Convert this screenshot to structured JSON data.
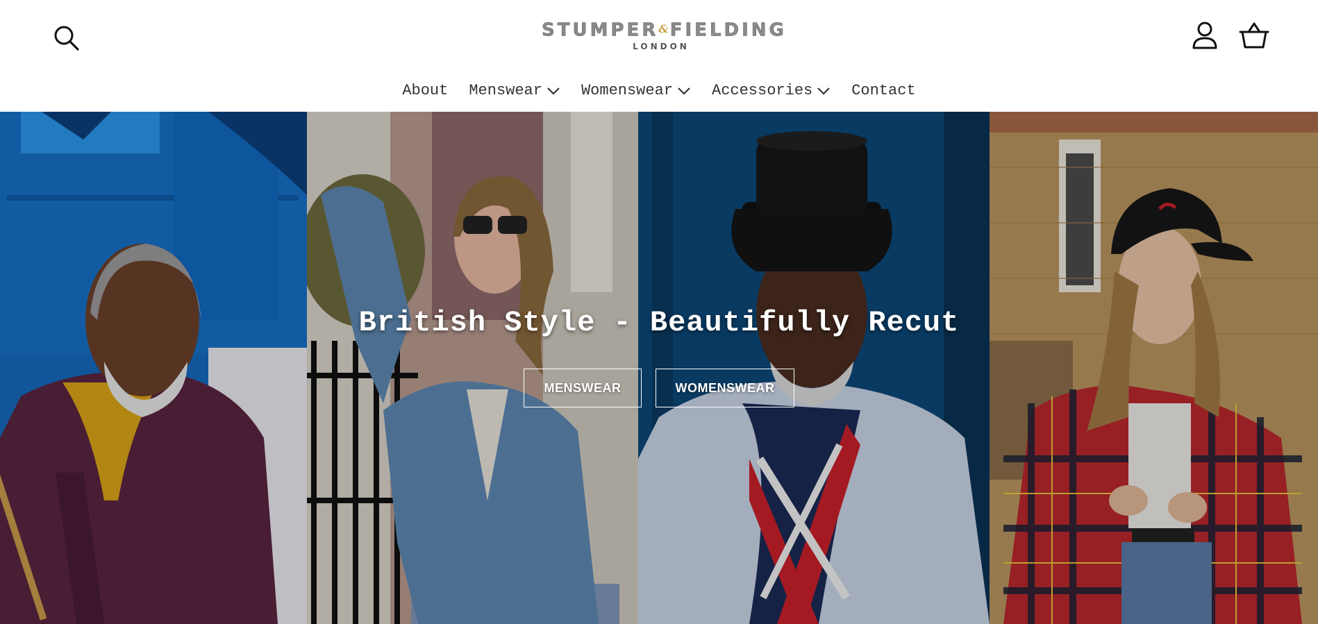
{
  "header": {
    "logo": {
      "main_left": "STUMPER",
      "ampersand": "&",
      "main_right": "FIELDING",
      "sub": "LONDON"
    },
    "icons": {
      "search": "search-icon",
      "account": "user-icon",
      "cart": "basket-icon"
    }
  },
  "nav": {
    "items": [
      {
        "label": "About",
        "has_dropdown": false
      },
      {
        "label": "Menswear",
        "has_dropdown": true
      },
      {
        "label": "Womenswear",
        "has_dropdown": true
      },
      {
        "label": "Accessories",
        "has_dropdown": true
      },
      {
        "label": "Contact",
        "has_dropdown": false
      }
    ]
  },
  "hero": {
    "title": "British Style - Beautifully Recut",
    "buttons": {
      "menswear": "MENSWEAR",
      "womenswear": "WOMENSWEAR"
    }
  },
  "colors": {
    "text": "#333333",
    "logo_gold": "#c9a24d",
    "logo_grey": "#8a8a8a",
    "hero_text": "#ffffff"
  }
}
